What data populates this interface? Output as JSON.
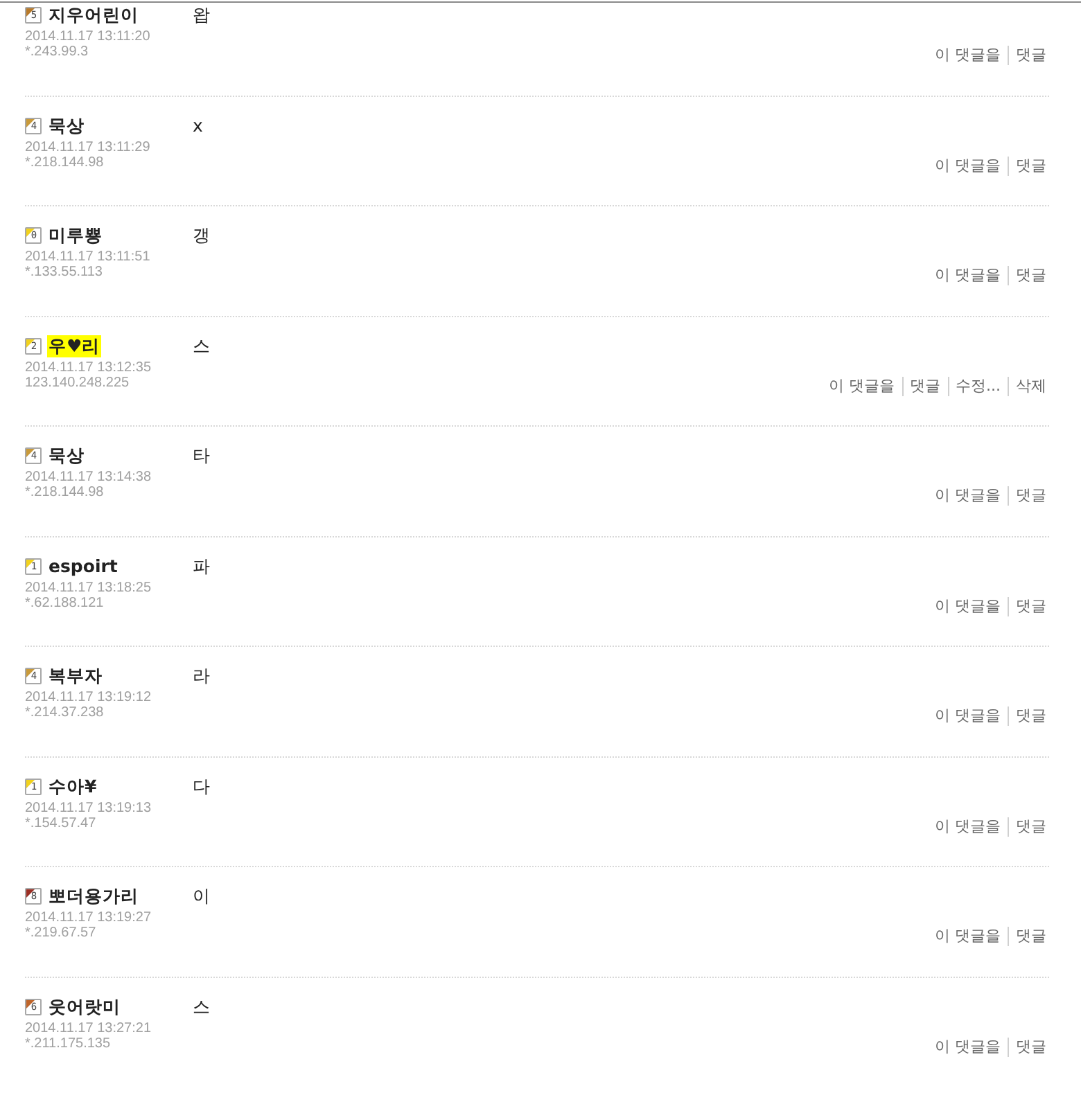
{
  "comments": [
    {
      "author": "지우어린이",
      "rank": "5",
      "color": "#b87a2a",
      "highlighted": false,
      "date": "2014.11.17 13:11:20",
      "ip": "*.243.99.3",
      "text": "왑",
      "actions": [
        "이 댓글을",
        "댓글"
      ]
    },
    {
      "author": "묵상",
      "rank": "4",
      "color": "#c99a3a",
      "highlighted": false,
      "date": "2014.11.17 13:11:29",
      "ip": "*.218.144.98",
      "text": "x",
      "actions": [
        "이 댓글을",
        "댓글"
      ]
    },
    {
      "author": "미루뿅",
      "rank": "0",
      "color": "#f2d21c",
      "highlighted": false,
      "date": "2014.11.17 13:11:51",
      "ip": "*.133.55.113",
      "text": "갱",
      "actions": [
        "이 댓글을",
        "댓글"
      ]
    },
    {
      "author": "우♥리",
      "rank": "2",
      "color": "#f2d21c",
      "highlighted": true,
      "date": "2014.11.17 13:12:35",
      "ip": "123.140.248.225",
      "text": "스",
      "actions": [
        "이 댓글을",
        "댓글",
        "수정...",
        "삭제"
      ]
    },
    {
      "author": "묵상",
      "rank": "4",
      "color": "#c99a3a",
      "highlighted": false,
      "date": "2014.11.17 13:14:38",
      "ip": "*.218.144.98",
      "text": "타",
      "actions": [
        "이 댓글을",
        "댓글"
      ]
    },
    {
      "author": "espoirt",
      "rank": "1",
      "color": "#f2d21c",
      "highlighted": false,
      "date": "2014.11.17 13:18:25",
      "ip": "*.62.188.121",
      "text": "파",
      "actions": [
        "이 댓글을",
        "댓글"
      ]
    },
    {
      "author": "복부자",
      "rank": "4",
      "color": "#c99a3a",
      "highlighted": false,
      "date": "2014.11.17 13:19:12",
      "ip": "*.214.37.238",
      "text": "라",
      "actions": [
        "이 댓글을",
        "댓글"
      ]
    },
    {
      "author": "수아¥",
      "rank": "1",
      "color": "#f2d21c",
      "highlighted": false,
      "date": "2014.11.17 13:19:13",
      "ip": "*.154.57.47",
      "text": "다",
      "actions": [
        "이 댓글을",
        "댓글"
      ]
    },
    {
      "author": "뽀더용가리",
      "rank": "8",
      "color": "#9c2f24",
      "highlighted": false,
      "date": "2014.11.17 13:19:27",
      "ip": "*.219.67.57",
      "text": "이",
      "actions": [
        "이 댓글을",
        "댓글"
      ]
    },
    {
      "author": "웃어랏미",
      "rank": "6",
      "color": "#c0652a",
      "highlighted": false,
      "date": "2014.11.17 13:27:21",
      "ip": "*.211.175.135",
      "text": "스",
      "actions": [
        "이 댓글을",
        "댓글"
      ]
    }
  ]
}
